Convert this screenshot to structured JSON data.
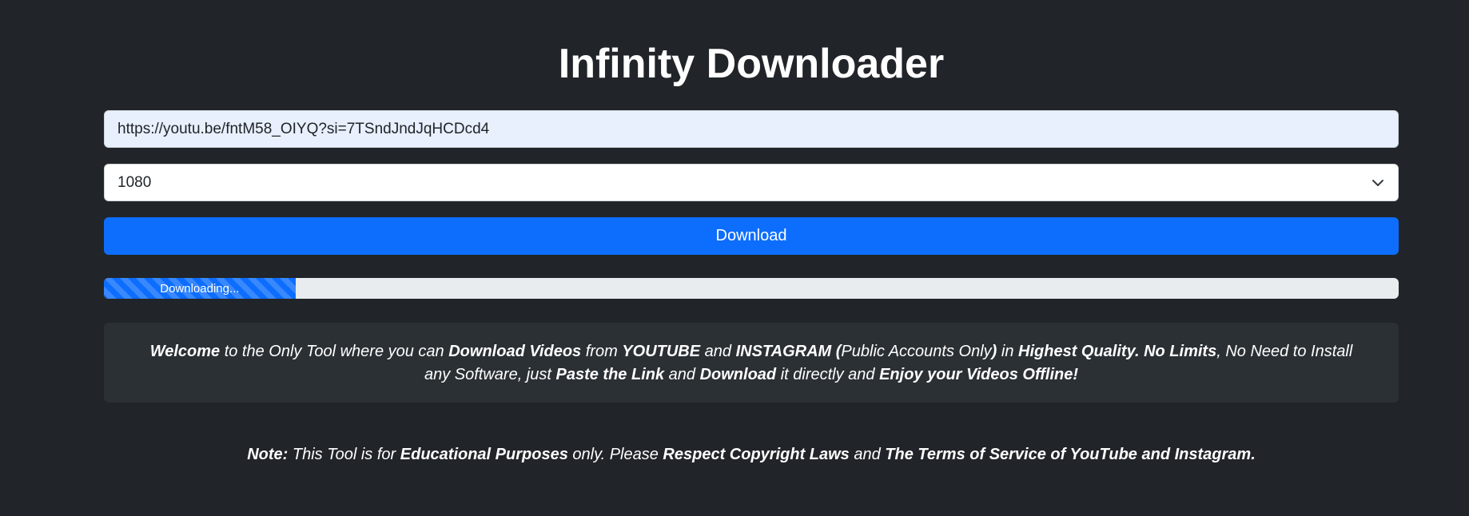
{
  "app": {
    "title": "Infinity Downloader"
  },
  "form": {
    "url_value": "https://youtu.be/fntM58_OIYQ?si=7TSndJndJqHCDcd4",
    "quality_selected": "1080",
    "download_label": "Download"
  },
  "progress": {
    "label": "Downloading...",
    "fraction": 0.148
  },
  "info": {
    "s1": "Welcome",
    "s2": " to the Only Tool where you can ",
    "s3": "Download Videos",
    "s4": " from ",
    "s5": "YOUTUBE",
    "s6": " and ",
    "s7": "INSTAGRAM (",
    "s8": "Public Accounts Only",
    "s9": ")",
    "s10": " in ",
    "s11": "Highest Quality. No Limits",
    "s12": ", No Need to Install any Software, just ",
    "s13": "Paste the Link",
    "s14": " and ",
    "s15": "Download",
    "s16": " it directly and ",
    "s17": "Enjoy your Videos Offline!"
  },
  "note": {
    "n1": "Note:",
    "n2": " This Tool is for ",
    "n3": "Educational Purposes",
    "n4": " only. Please ",
    "n5": "Respect Copyright Laws",
    "n6": " and ",
    "n7": "The Terms of Service of YouTube and Instagram."
  },
  "colors": {
    "background": "#212529",
    "primary": "#0d6efd",
    "info_box": "#2b3035",
    "input_autofill": "#e8f0fe"
  },
  "icons": {
    "select_arrow": "chevron-down-icon"
  }
}
